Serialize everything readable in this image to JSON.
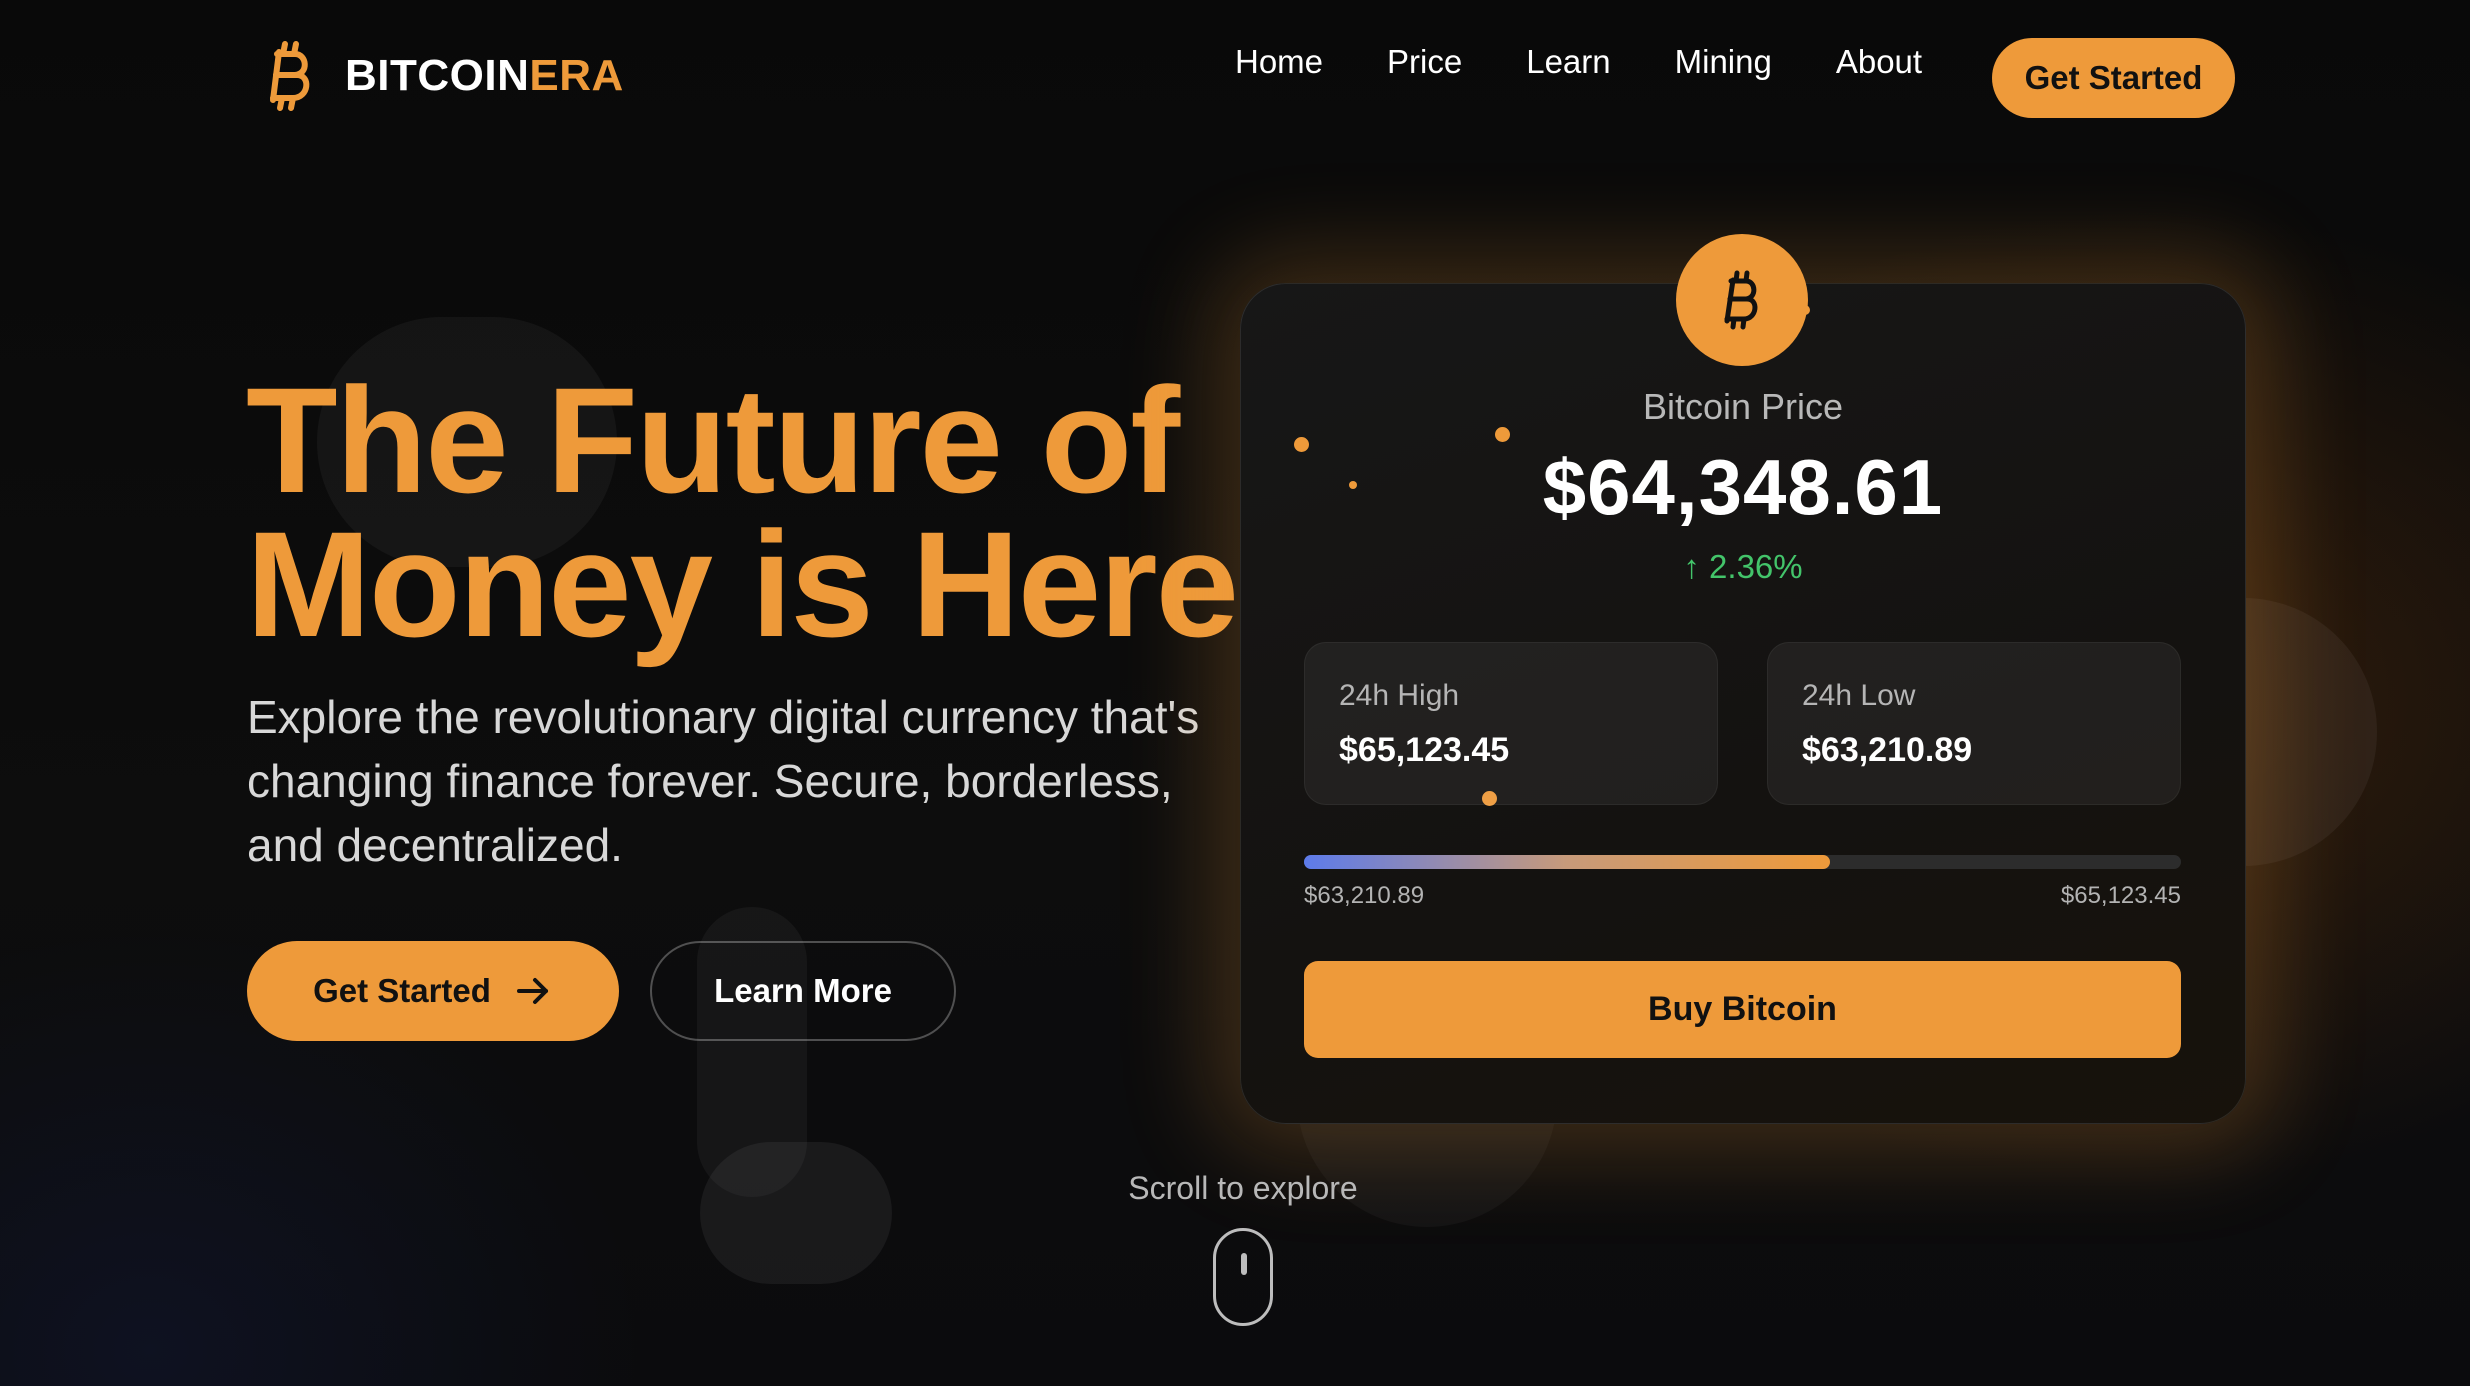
{
  "brand": {
    "name_main": "BITCOIN",
    "name_accent": "ERA"
  },
  "nav": {
    "items": [
      {
        "label": "Home"
      },
      {
        "label": "Price"
      },
      {
        "label": "Learn"
      },
      {
        "label": "Mining"
      },
      {
        "label": "About"
      }
    ],
    "cta_label": "Get Started"
  },
  "hero": {
    "title_line1": "The Future of",
    "title_line2": "Money is Here",
    "subtitle": "Explore the revolutionary digital currency that's changing finance forever. Secure, borderless, and decentralized.",
    "primary_label": "Get Started",
    "secondary_label": "Learn More"
  },
  "price_card": {
    "label": "Bitcoin Price",
    "price": "$64,348.61",
    "change": "↑ 2.36%",
    "high_label": "24h High",
    "high_value": "$65,123.45",
    "low_label": "24h Low",
    "low_value": "$63,210.89",
    "range_min": "$63,210.89",
    "range_max": "$65,123.45",
    "range_fill_fraction": 0.6,
    "buy_label": "Buy Bitcoin"
  },
  "scroll": {
    "label": "Scroll to explore"
  },
  "colors": {
    "accent": "#ee9a3a",
    "background": "#0b0b0b",
    "positive": "#43c46a",
    "range_start": "#5d7bea"
  },
  "icons": {
    "logo": "bitcoin-icon",
    "coin": "bitcoin-icon",
    "primary_button": "arrow-right-icon",
    "scroll": "mouse-icon"
  }
}
